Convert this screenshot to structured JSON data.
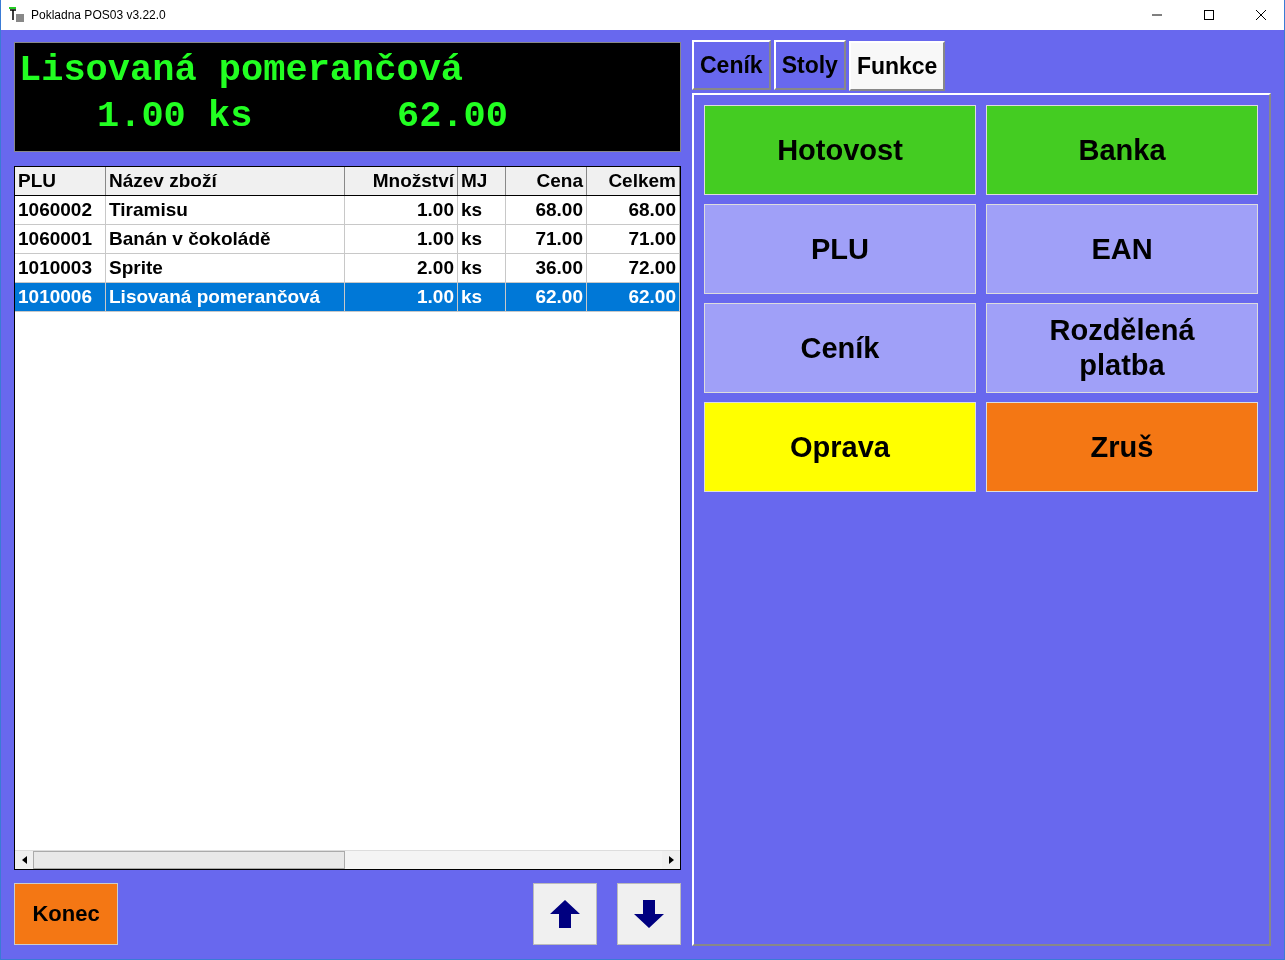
{
  "window": {
    "title": "Pokladna POS03 v3.22.0"
  },
  "display": {
    "line_1": "Lisovaná pomerančová",
    "quantity": "1.00 ks",
    "amount": "62.00"
  },
  "table": {
    "columns": [
      "PLU",
      "Název zboží",
      "Množství",
      "MJ",
      "Cena",
      "Celkem"
    ],
    "rows": [
      {
        "cells": [
          "1060002",
          "Tiramisu",
          "1.00",
          "ks",
          "68.00",
          "68.00"
        ],
        "selected": false
      },
      {
        "cells": [
          "1060001",
          "Banán v čokoládě",
          "1.00",
          "ks",
          "71.00",
          "71.00"
        ],
        "selected": false
      },
      {
        "cells": [
          "1010003",
          "Sprite",
          "2.00",
          "ks",
          "36.00",
          "72.00"
        ],
        "selected": false
      },
      {
        "cells": [
          "1010006",
          "Lisovaná pomerančová",
          "1.00",
          "ks",
          "62.00",
          "62.00"
        ],
        "selected": true
      }
    ]
  },
  "bottom": {
    "exit_button": "Konec"
  },
  "tabs": [
    {
      "label": "Ceník",
      "selected": false
    },
    {
      "label": "Stoly",
      "selected": false
    },
    {
      "label": "Funkce",
      "selected": true
    }
  ],
  "function_rows": [
    {
      "buttons": [
        {
          "label": "Hotovost",
          "color": "#44cc22"
        },
        {
          "label": "Banka",
          "color": "#44cc22"
        }
      ]
    },
    {
      "buttons": [
        {
          "label": "PLU",
          "color": "#a0a0f8"
        },
        {
          "label": "EAN",
          "color": "#a0a0f8"
        }
      ]
    },
    {
      "buttons": [
        {
          "label": "Ceník",
          "color": "#a0a0f8"
        },
        {
          "label": "Rozdělená platba",
          "color": "#a0a0f8"
        }
      ]
    },
    {
      "buttons": [
        {
          "label": "Oprava",
          "color": "#ffff00"
        },
        {
          "label": "Zruš",
          "color": "#f47714"
        }
      ]
    }
  ]
}
